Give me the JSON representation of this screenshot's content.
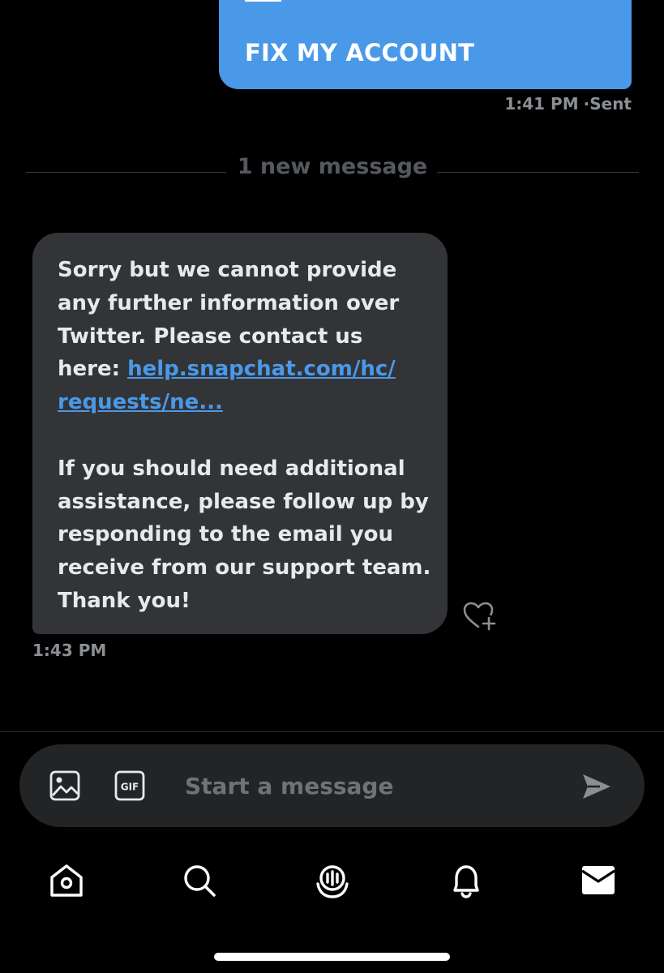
{
  "sent_message": {
    "text": "FIX MY ACCOUNT",
    "time": "1:41 PM",
    "status": "Sent",
    "bubble_color": "#4a99e9"
  },
  "divider": {
    "label": "1 new message"
  },
  "received_message": {
    "para1_before_link": "Sorry but we cannot provide any further information over Twitter. Please contact us here: ",
    "link_line1": "help.snapchat.com/hc/",
    "link_line2": "requests/ne...",
    "para2": "If you should need additional assistance, please follow up by responding to the email you receive from our support team. Thank you!",
    "time": "1:43 PM",
    "bubble_color": "#333437",
    "link_color": "#4a99e9",
    "reaction_icon": "heart-plus-icon"
  },
  "composer": {
    "placeholder": "Start a message",
    "media_icon": "image-icon",
    "gif_icon": "gif-icon",
    "send_icon": "send-icon"
  },
  "nav": {
    "items": [
      {
        "name": "home",
        "icon": "home-icon"
      },
      {
        "name": "search",
        "icon": "search-icon"
      },
      {
        "name": "spaces",
        "icon": "spaces-icon"
      },
      {
        "name": "notifications",
        "icon": "bell-icon"
      },
      {
        "name": "messages",
        "icon": "envelope-icon",
        "active": true
      }
    ]
  },
  "colors": {
    "background": "#000000",
    "accent": "#4a99e9",
    "muted_text": "#8b8f94"
  }
}
